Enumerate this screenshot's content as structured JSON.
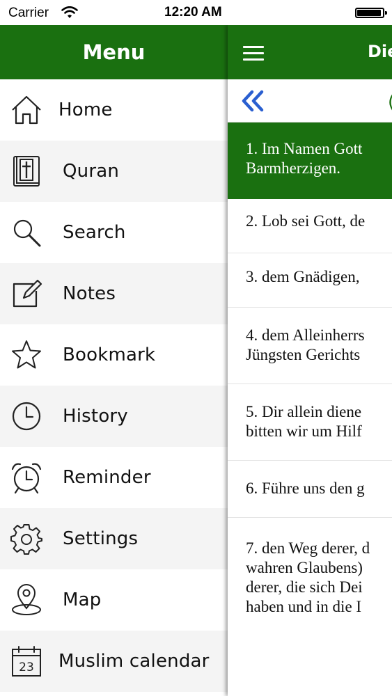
{
  "status_bar": {
    "carrier": "Carrier",
    "time": "12:20 AM"
  },
  "menu": {
    "title": "Menu",
    "items": [
      {
        "label": "Home",
        "icon": "home-icon"
      },
      {
        "label": "Quran",
        "icon": "book-icon"
      },
      {
        "label": "Search",
        "icon": "search-icon"
      },
      {
        "label": "Notes",
        "icon": "notes-icon"
      },
      {
        "label": "Bookmark",
        "icon": "star-icon"
      },
      {
        "label": "History",
        "icon": "clock-icon"
      },
      {
        "label": "Reminder",
        "icon": "alarm-clock-icon"
      },
      {
        "label": "Settings",
        "icon": "gear-icon"
      },
      {
        "label": "Map",
        "icon": "map-pin-icon"
      },
      {
        "label": "Muslim calendar",
        "icon": "calendar-icon"
      }
    ],
    "calendar_day": "23"
  },
  "content": {
    "title": "Die",
    "nav_right": "(",
    "verses": [
      {
        "lines": [
          "1. Im Namen Gott",
          "Barmherzigen."
        ]
      },
      {
        "lines": [
          "2. Lob sei Gott, de"
        ]
      },
      {
        "lines": [
          "3. dem Gnädigen,"
        ]
      },
      {
        "lines": [
          "4. dem Alleinherrs",
          "Jüngsten Gerichts"
        ]
      },
      {
        "lines": [
          "5. Dir allein diene",
          "bitten wir um Hilf"
        ]
      },
      {
        "lines": [
          "6. Führe uns den g"
        ]
      },
      {
        "lines": [
          "7. den Weg derer, d",
          "wahren Glaubens)",
          "derer, die sich Dei",
          "haben und in die I"
        ]
      }
    ]
  },
  "colors": {
    "primary_green": "#1a7010",
    "white": "#ffffff",
    "alt_row": "#f4f4f4",
    "chevron_blue": "#2a5fd0"
  }
}
